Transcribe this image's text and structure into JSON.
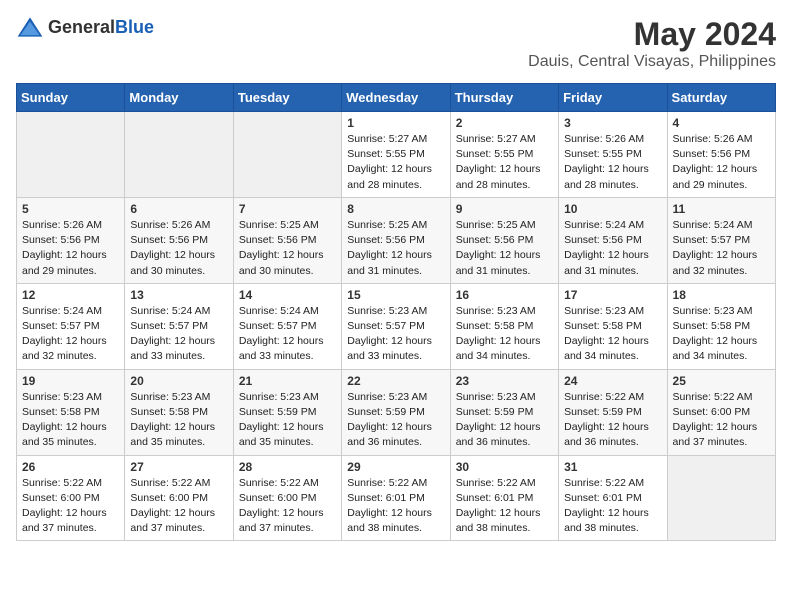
{
  "logo": {
    "general": "General",
    "blue": "Blue"
  },
  "title": "May 2024",
  "subtitle": "Dauis, Central Visayas, Philippines",
  "weekdays": [
    "Sunday",
    "Monday",
    "Tuesday",
    "Wednesday",
    "Thursday",
    "Friday",
    "Saturday"
  ],
  "weeks": [
    [
      {
        "day": "",
        "info": ""
      },
      {
        "day": "",
        "info": ""
      },
      {
        "day": "",
        "info": ""
      },
      {
        "day": "1",
        "info": "Sunrise: 5:27 AM\nSunset: 5:55 PM\nDaylight: 12 hours\nand 28 minutes."
      },
      {
        "day": "2",
        "info": "Sunrise: 5:27 AM\nSunset: 5:55 PM\nDaylight: 12 hours\nand 28 minutes."
      },
      {
        "day": "3",
        "info": "Sunrise: 5:26 AM\nSunset: 5:55 PM\nDaylight: 12 hours\nand 28 minutes."
      },
      {
        "day": "4",
        "info": "Sunrise: 5:26 AM\nSunset: 5:56 PM\nDaylight: 12 hours\nand 29 minutes."
      }
    ],
    [
      {
        "day": "5",
        "info": "Sunrise: 5:26 AM\nSunset: 5:56 PM\nDaylight: 12 hours\nand 29 minutes."
      },
      {
        "day": "6",
        "info": "Sunrise: 5:26 AM\nSunset: 5:56 PM\nDaylight: 12 hours\nand 30 minutes."
      },
      {
        "day": "7",
        "info": "Sunrise: 5:25 AM\nSunset: 5:56 PM\nDaylight: 12 hours\nand 30 minutes."
      },
      {
        "day": "8",
        "info": "Sunrise: 5:25 AM\nSunset: 5:56 PM\nDaylight: 12 hours\nand 31 minutes."
      },
      {
        "day": "9",
        "info": "Sunrise: 5:25 AM\nSunset: 5:56 PM\nDaylight: 12 hours\nand 31 minutes."
      },
      {
        "day": "10",
        "info": "Sunrise: 5:24 AM\nSunset: 5:56 PM\nDaylight: 12 hours\nand 31 minutes."
      },
      {
        "day": "11",
        "info": "Sunrise: 5:24 AM\nSunset: 5:57 PM\nDaylight: 12 hours\nand 32 minutes."
      }
    ],
    [
      {
        "day": "12",
        "info": "Sunrise: 5:24 AM\nSunset: 5:57 PM\nDaylight: 12 hours\nand 32 minutes."
      },
      {
        "day": "13",
        "info": "Sunrise: 5:24 AM\nSunset: 5:57 PM\nDaylight: 12 hours\nand 33 minutes."
      },
      {
        "day": "14",
        "info": "Sunrise: 5:24 AM\nSunset: 5:57 PM\nDaylight: 12 hours\nand 33 minutes."
      },
      {
        "day": "15",
        "info": "Sunrise: 5:23 AM\nSunset: 5:57 PM\nDaylight: 12 hours\nand 33 minutes."
      },
      {
        "day": "16",
        "info": "Sunrise: 5:23 AM\nSunset: 5:58 PM\nDaylight: 12 hours\nand 34 minutes."
      },
      {
        "day": "17",
        "info": "Sunrise: 5:23 AM\nSunset: 5:58 PM\nDaylight: 12 hours\nand 34 minutes."
      },
      {
        "day": "18",
        "info": "Sunrise: 5:23 AM\nSunset: 5:58 PM\nDaylight: 12 hours\nand 34 minutes."
      }
    ],
    [
      {
        "day": "19",
        "info": "Sunrise: 5:23 AM\nSunset: 5:58 PM\nDaylight: 12 hours\nand 35 minutes."
      },
      {
        "day": "20",
        "info": "Sunrise: 5:23 AM\nSunset: 5:58 PM\nDaylight: 12 hours\nand 35 minutes."
      },
      {
        "day": "21",
        "info": "Sunrise: 5:23 AM\nSunset: 5:59 PM\nDaylight: 12 hours\nand 35 minutes."
      },
      {
        "day": "22",
        "info": "Sunrise: 5:23 AM\nSunset: 5:59 PM\nDaylight: 12 hours\nand 36 minutes."
      },
      {
        "day": "23",
        "info": "Sunrise: 5:23 AM\nSunset: 5:59 PM\nDaylight: 12 hours\nand 36 minutes."
      },
      {
        "day": "24",
        "info": "Sunrise: 5:22 AM\nSunset: 5:59 PM\nDaylight: 12 hours\nand 36 minutes."
      },
      {
        "day": "25",
        "info": "Sunrise: 5:22 AM\nSunset: 6:00 PM\nDaylight: 12 hours\nand 37 minutes."
      }
    ],
    [
      {
        "day": "26",
        "info": "Sunrise: 5:22 AM\nSunset: 6:00 PM\nDaylight: 12 hours\nand 37 minutes."
      },
      {
        "day": "27",
        "info": "Sunrise: 5:22 AM\nSunset: 6:00 PM\nDaylight: 12 hours\nand 37 minutes."
      },
      {
        "day": "28",
        "info": "Sunrise: 5:22 AM\nSunset: 6:00 PM\nDaylight: 12 hours\nand 37 minutes."
      },
      {
        "day": "29",
        "info": "Sunrise: 5:22 AM\nSunset: 6:01 PM\nDaylight: 12 hours\nand 38 minutes."
      },
      {
        "day": "30",
        "info": "Sunrise: 5:22 AM\nSunset: 6:01 PM\nDaylight: 12 hours\nand 38 minutes."
      },
      {
        "day": "31",
        "info": "Sunrise: 5:22 AM\nSunset: 6:01 PM\nDaylight: 12 hours\nand 38 minutes."
      },
      {
        "day": "",
        "info": ""
      }
    ]
  ]
}
